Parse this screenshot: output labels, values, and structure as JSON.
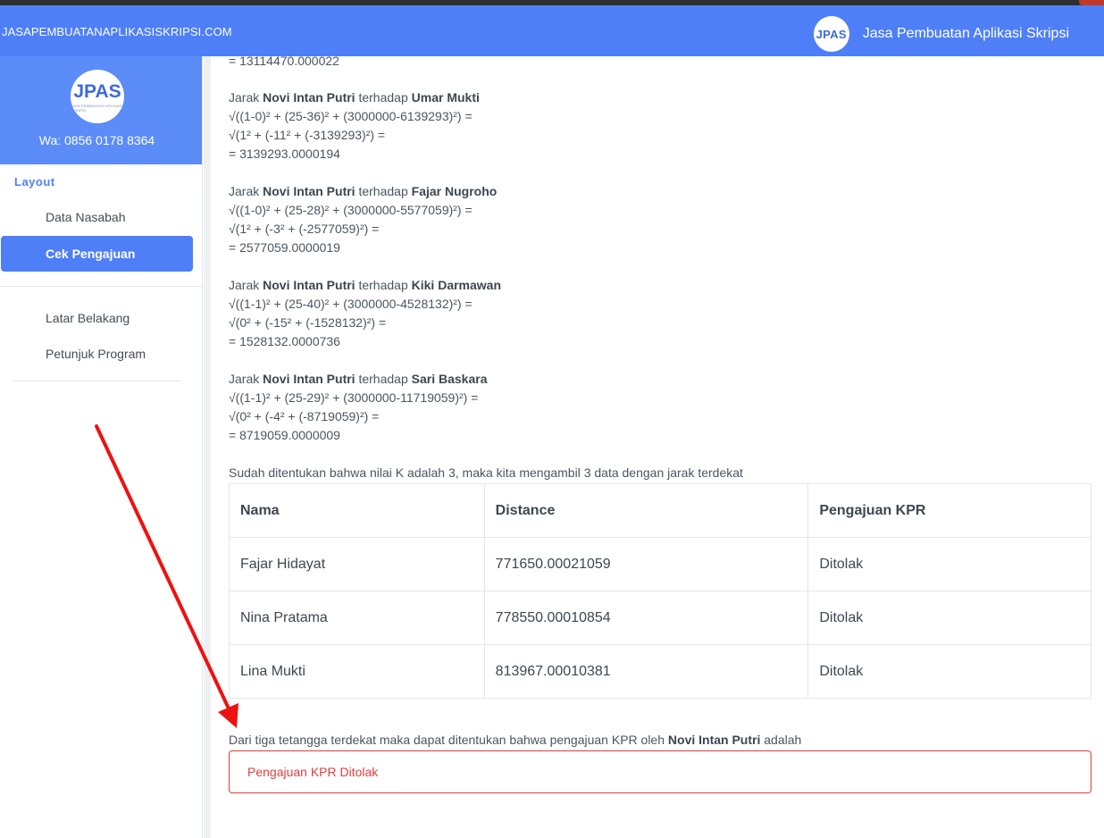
{
  "navbar": {
    "site_url": "JASAPEMBUATANAPLIKASISKRIPSI.COM",
    "logo_text": "JPAS",
    "title": "Jasa Pembuatan Aplikasi Skripsi"
  },
  "sidebar": {
    "logo_text": "JPAS",
    "logo_subtext": "JASA PEMBUATAN APLIKASI SKRIPSI",
    "whatsapp": "Wa: 0856 0178 8364",
    "section_label": "Layout",
    "items": [
      {
        "label": "Data Nasabah"
      },
      {
        "label": "Cek Pengajuan"
      },
      {
        "label": "Latar Belakang"
      },
      {
        "label": "Petunjuk Program"
      }
    ]
  },
  "calc": {
    "top_result": "= 13114470.000022",
    "prefix": "Jarak",
    "subject": "Novi Intan Putri",
    "relation": "terhadap",
    "blocks": [
      {
        "target": "Umar Mukti",
        "l1": "√((1-0)² + (25-36)² + (3000000-6139293)²) =",
        "l2": "√(1² + (-11² + (-3139293)²) =",
        "l3": "= 3139293.0000194"
      },
      {
        "target": "Fajar Nugroho",
        "l1": "√((1-0)² + (25-28)² + (3000000-5577059)²) =",
        "l2": "√(1² + (-3² + (-2577059)²) =",
        "l3": "= 2577059.0000019"
      },
      {
        "target": "Kiki Darmawan",
        "l1": "√((1-1)² + (25-40)² + (3000000-4528132)²) =",
        "l2": "√(0² + (-15² + (-1528132)²) =",
        "l3": "= 1528132.0000736"
      },
      {
        "target": "Sari Baskara",
        "l1": "√((1-1)² + (25-29)² + (3000000-11719059)²) =",
        "l2": "√(0² + (-4² + (-8719059)²) =",
        "l3": "= 8719059.0000009"
      }
    ],
    "k_statement": "Sudah ditentukan bahwa nilai K adalah 3, maka kita mengambil 3 data dengan jarak terdekat"
  },
  "table": {
    "headers": [
      "Nama",
      "Distance",
      "Pengajuan KPR"
    ],
    "rows": [
      [
        "Fajar Hidayat",
        "771650.00021059",
        "Ditolak"
      ],
      [
        "Nina Pratama",
        "778550.00010854",
        "Ditolak"
      ],
      [
        "Lina Mukti",
        "813967.00010381",
        "Ditolak"
      ]
    ]
  },
  "conclusion": {
    "text_before": "Dari tiga tetangga terdekat maka dapat ditentukan bahwa pengajuan KPR oleh",
    "subject": "Novi Intan Putri",
    "text_after": "adalah",
    "alert": "Pengajuan KPR Ditolak"
  },
  "colors": {
    "primary": "#4e7ff7",
    "sidebar_header": "#5b8cf8",
    "danger": "#e33e3e",
    "annotation_arrow": "#ee1111"
  }
}
